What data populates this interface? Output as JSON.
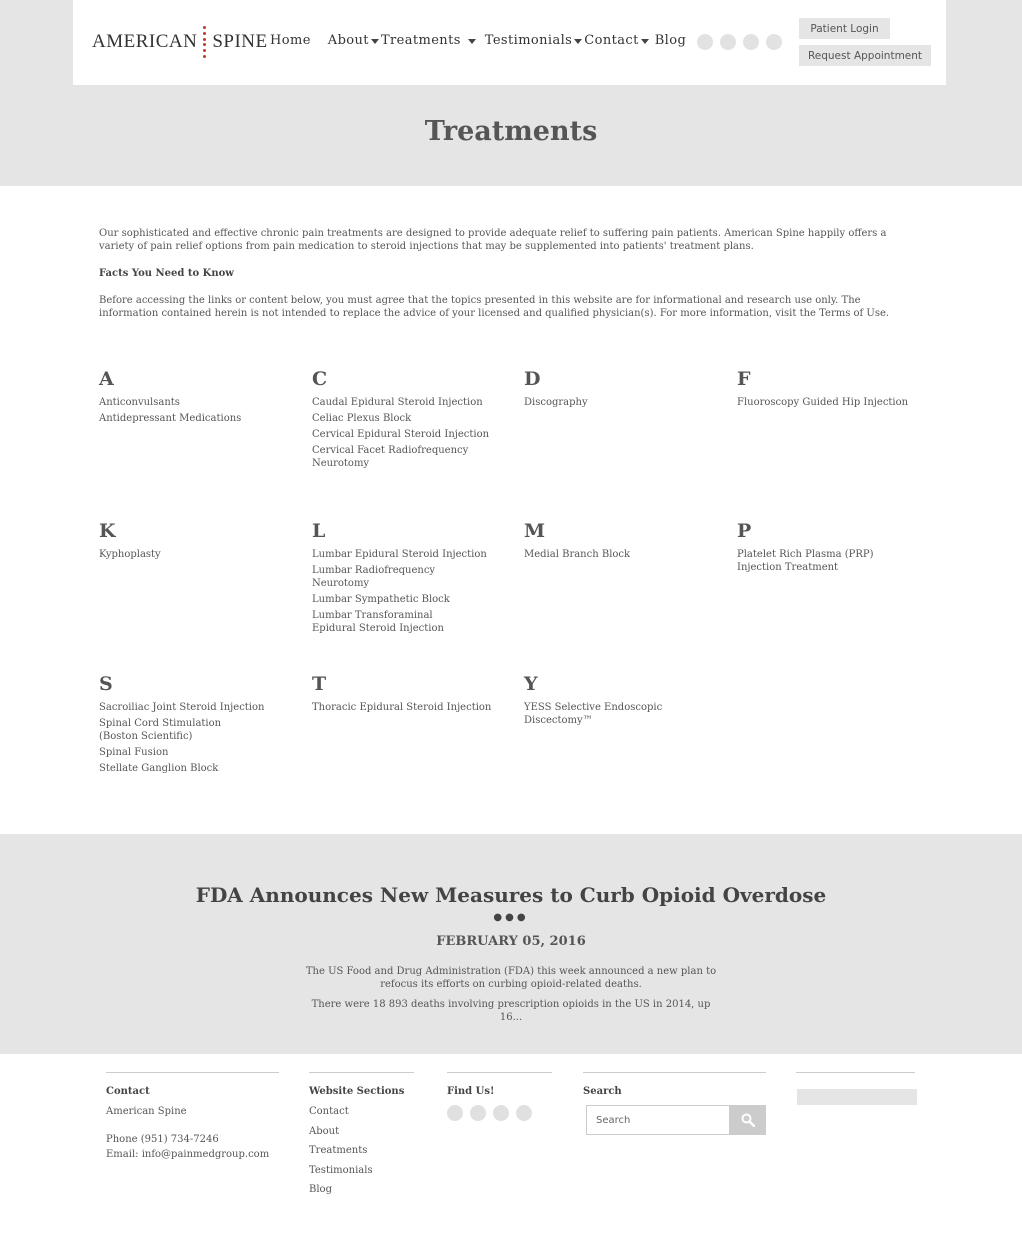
{
  "brand": {
    "left": "AMERICAN",
    "right": "SPINE"
  },
  "nav": [
    {
      "label": "Home",
      "caret": false
    },
    {
      "label": "About",
      "caret": true
    },
    {
      "label": "Treatments",
      "caret": true
    },
    {
      "label": "Testimonials",
      "caret": true
    },
    {
      "label": "Contact",
      "caret": true
    },
    {
      "label": "Blog",
      "caret": false
    }
  ],
  "header_socials": [
    "social-icon-1",
    "social-icon-2",
    "social-icon-3",
    "social-icon-4"
  ],
  "buttons": {
    "login": "Patient Login",
    "appointment": "Request Appointment"
  },
  "page_title": "Treatments",
  "intro": {
    "paragraph": "Our sophisticated and effective chronic pain treatments are designed to provide adequate relief to suffering pain patients. American Spine happily offers a variety of pain relief options from pain medication to steroid injections that may be supplemented into patients' treatment plans.",
    "facts_heading": "Facts You Need to Know",
    "disclaimer": "Before accessing the links or content below, you must agree that the topics presented in this website are for informational and research use only. The information contained herein is not intended to replace the advice of your licensed and qualified physician(s). For more information, visit the Terms of Use."
  },
  "treatments": [
    {
      "letter": "A",
      "items": [
        "Anticonvulsants",
        "Antidepressant Medications"
      ]
    },
    {
      "letter": "C",
      "items": [
        "Caudal Epidural Steroid Injection",
        "Celiac Plexus Block",
        "Cervical Epidural Steroid Injection",
        "Cervical Facet Radiofrequency Neurotomy"
      ]
    },
    {
      "letter": "D",
      "items": [
        "Discography"
      ]
    },
    {
      "letter": "F",
      "items": [
        "Fluoroscopy Guided Hip Injection"
      ]
    },
    {
      "letter": "K",
      "items": [
        "Kyphoplasty"
      ]
    },
    {
      "letter": "L",
      "items": [
        "Lumbar Epidural Steroid Injection",
        "Lumbar Radiofrequency Neurotomy",
        "Lumbar Sympathetic Block",
        "Lumbar Transforaminal Epidural Steroid Injection"
      ]
    },
    {
      "letter": "M",
      "items": [
        "Medial Branch Block"
      ]
    },
    {
      "letter": "P",
      "items": [
        "Platelet Rich Plasma (PRP) Injection Treatment"
      ]
    },
    {
      "letter": "S",
      "items": [
        "Sacroiliac Joint Steroid Injection",
        "Spinal Cord Stimulation (Boston Scientific)",
        "Spinal Fusion",
        "Stellate Ganglion Block"
      ]
    },
    {
      "letter": "T",
      "items": [
        "Thoracic Epidural Steroid Injection"
      ]
    },
    {
      "letter": "Y",
      "items": [
        "YESS Selective Endoscopic Discectomy™"
      ]
    }
  ],
  "news": {
    "title": "FDA Announces New Measures to Curb Opioid Overdose",
    "dots": "●●●",
    "date": "FEBRUARY 05, 2016",
    "p1": "The US Food and Drug Administration (FDA) this week announced a new plan to refocus its efforts on curbing opioid-related deaths.",
    "p2": "There were 18 893 deaths involving prescription opioids in the US in 2014, up 16..."
  },
  "footer": {
    "contact": {
      "heading": "Contact",
      "name": "American Spine",
      "phone": "Phone (951) 734-7246",
      "email": "Email: info@painmedgroup.com"
    },
    "sections": {
      "heading": "Website Sections",
      "links": [
        "Contact",
        "About",
        "Treatments",
        "Testimonials",
        "Blog"
      ]
    },
    "find_us": {
      "heading": "Find Us!"
    },
    "search": {
      "heading": "Search",
      "placeholder": "Search"
    }
  }
}
